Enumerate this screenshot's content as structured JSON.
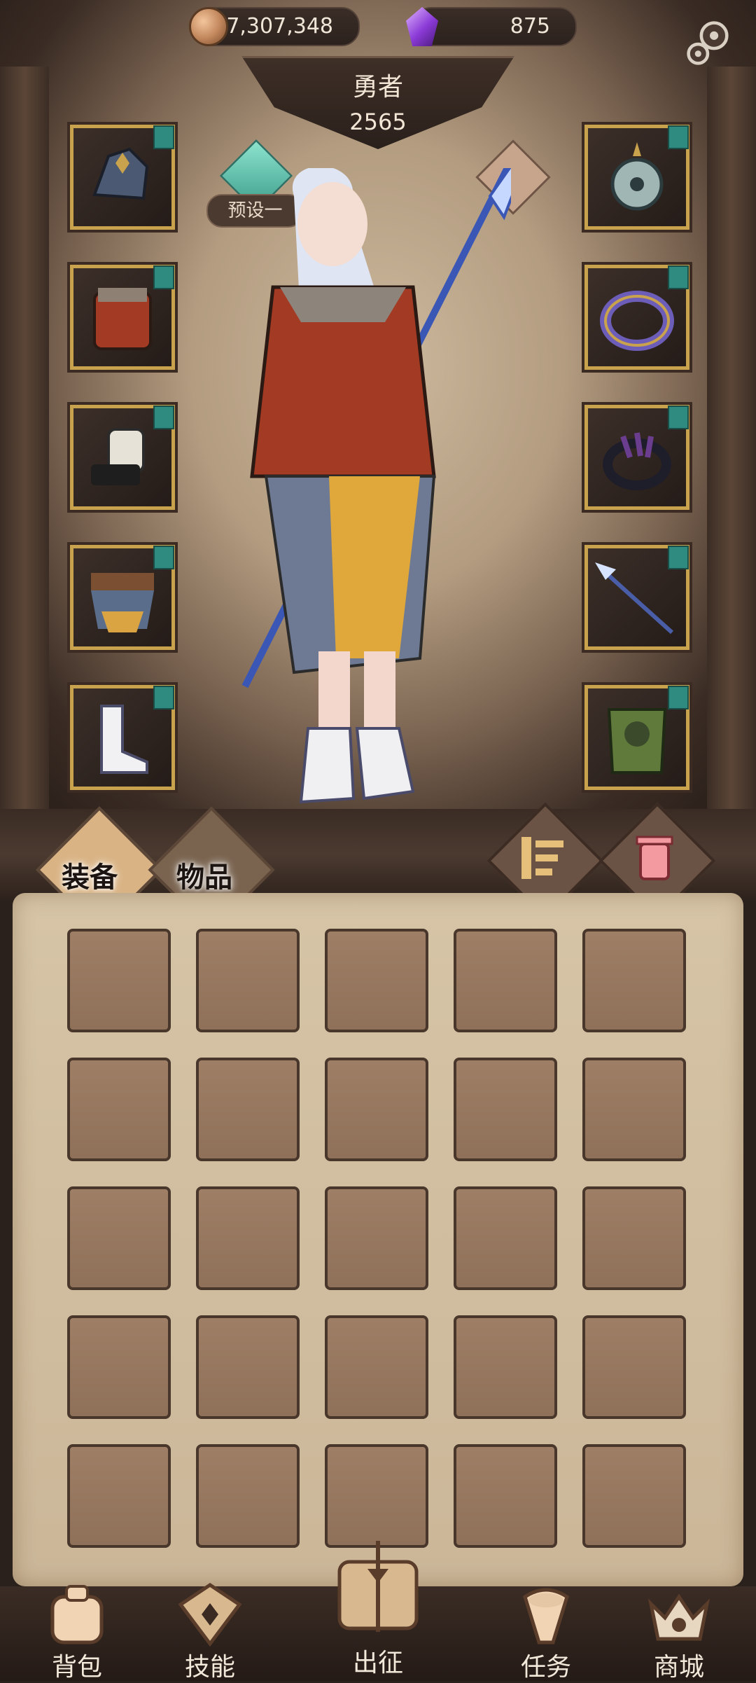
{
  "currency": {
    "gold": "7,307,348",
    "gems": "875"
  },
  "hero": {
    "name": "勇者",
    "power": "2565",
    "preset": "预设一"
  },
  "tabs": {
    "equip": "装备",
    "items": "物品"
  },
  "nav": [
    "背包",
    "技能",
    "出征",
    "任务",
    "商城"
  ],
  "equipment_slots": {
    "left": [
      "helmet-icon",
      "chest-armor-icon",
      "gloves-icon",
      "belt-icon",
      "boots-icon"
    ],
    "right": [
      "amulet-icon",
      "ring-icon",
      "claw-ring-icon",
      "spear-icon",
      "cloak-icon"
    ]
  },
  "colors": {
    "accent_teal": "#2f8a7f",
    "frame_gold": "#c9a24d",
    "parchment": "#d6c4a6"
  }
}
